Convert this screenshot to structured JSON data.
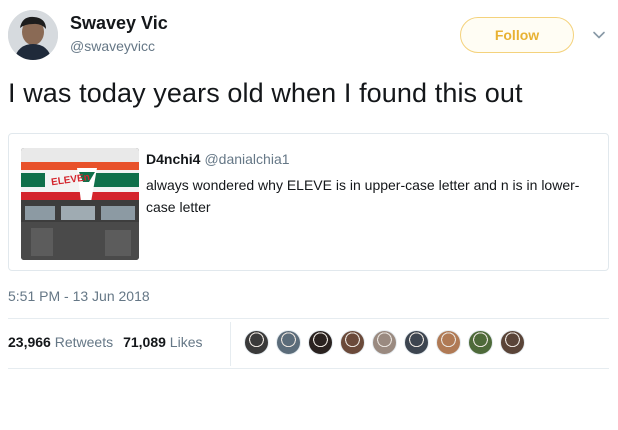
{
  "author": {
    "name": "Swavey Vic",
    "handle": "@swaveyvicc"
  },
  "follow_button": {
    "label": "Follow"
  },
  "tweet_text": "I was today years old when I found this out",
  "quoted_tweet": {
    "name": "D4nchi4",
    "handle": "@danialchia1",
    "text": "always wondered why ELEVE is in upper-case letter and n is in lower-case letter",
    "image": {
      "sign_text": "ELEVEn",
      "colors": {
        "orange": "#e8512a",
        "green": "#10704a",
        "red": "#d4242c"
      }
    }
  },
  "timestamp": "5:51 PM - 13 Jun 2018",
  "stats": {
    "retweets_count": "23,966",
    "retweets_label": "Retweets",
    "likes_count": "71,089",
    "likes_label": "Likes"
  },
  "likers": [
    {
      "icon": "avatar-icon",
      "color": "#3a3a3a"
    },
    {
      "icon": "avatar-icon",
      "color": "#5b6c7a"
    },
    {
      "icon": "avatar-icon",
      "color": "#2a2220"
    },
    {
      "icon": "avatar-icon",
      "color": "#6b4a3a"
    },
    {
      "icon": "avatar-icon",
      "color": "#9a8a80"
    },
    {
      "icon": "avatar-icon",
      "color": "#3d4550"
    },
    {
      "icon": "avatar-icon",
      "color": "#b07a55"
    },
    {
      "icon": "avatar-icon",
      "color": "#4e6a3a"
    },
    {
      "icon": "avatar-icon",
      "color": "#5a4438"
    }
  ],
  "colors": {
    "follow_accent": "#e8b233",
    "secondary_text": "#657786"
  }
}
